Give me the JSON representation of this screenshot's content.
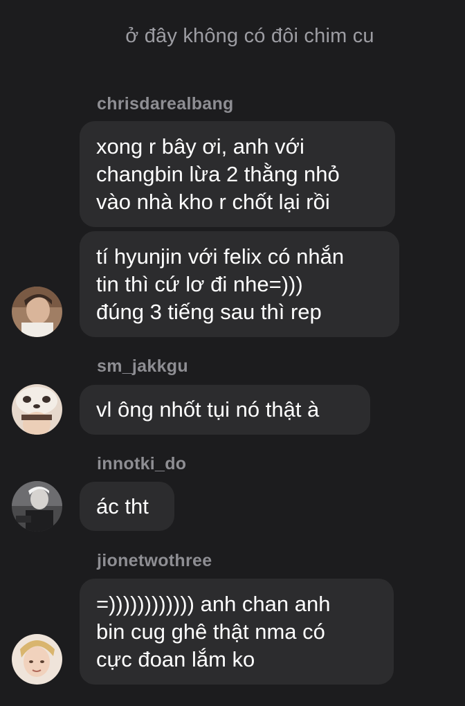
{
  "chat": {
    "title": "ở đây không có đôi chim cu"
  },
  "messages": [
    {
      "sender": "chrisdarealbang",
      "bubbles": [
        "xong r bây ơi, anh với\nchangbin lừa 2 thằng nhỏ\nvào nhà kho r chốt lại rồi",
        "tí hyunjin với felix có nhắn\ntin thì cứ lơ đi nhe=)))\nđúng 3 tiếng sau thì rep"
      ]
    },
    {
      "sender": "sm_jakkgu",
      "bubbles": [
        "vl ông nhốt tụi nó thật à"
      ]
    },
    {
      "sender": "innotki_do",
      "bubbles": [
        "ác tht"
      ]
    },
    {
      "sender": "jionetwothree",
      "bubbles": [
        "=)))))))))))) anh chan anh\nbin cug ghê thật nma có\ncực đoan lắm ko"
      ]
    }
  ]
}
